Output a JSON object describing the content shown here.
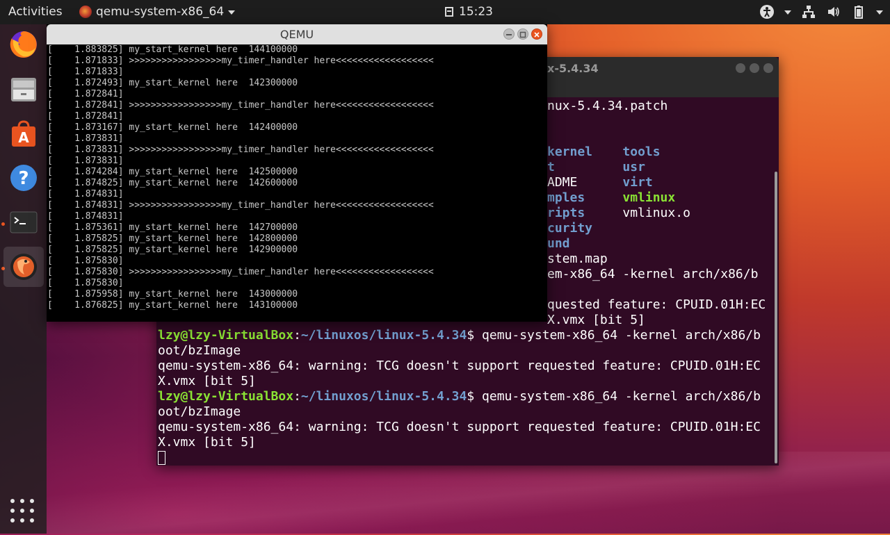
{
  "topbar": {
    "activities": "Activities",
    "app_name": "qemu-system-x86_64",
    "clock": "15:23"
  },
  "dock": {
    "items": [
      "firefox-icon",
      "files-icon",
      "software-icon",
      "help-icon",
      "terminal-icon",
      "qemu-icon"
    ],
    "show_apps": "show-apps-icon"
  },
  "terminal": {
    "title": "x-5.4.34",
    "lines": [
      {
        "parts": [
          {
            "t": "nux-5.4.34.patch",
            "c": "plain"
          }
        ]
      },
      {
        "parts": [
          {
            "t": "",
            "c": "plain"
          }
        ]
      },
      {
        "parts": [
          {
            "t": "",
            "c": "plain"
          }
        ]
      },
      {
        "parts": [
          {
            "t": "kernel",
            "c": "blue"
          },
          {
            "t": "    ",
            "c": "plain"
          },
          {
            "t": "tools",
            "c": "blue"
          }
        ]
      },
      {
        "parts": [
          {
            "t": "t",
            "c": "blue"
          },
          {
            "t": "         ",
            "c": "plain"
          },
          {
            "t": "usr",
            "c": "blue"
          }
        ]
      },
      {
        "parts": [
          {
            "t": "ADME",
            "c": "plain"
          },
          {
            "t": "      ",
            "c": "plain"
          },
          {
            "t": "virt",
            "c": "blue"
          }
        ]
      },
      {
        "parts": [
          {
            "t": "mples",
            "c": "blue"
          },
          {
            "t": "     ",
            "c": "plain"
          },
          {
            "t": "vmlinux",
            "c": "green"
          }
        ]
      },
      {
        "parts": [
          {
            "t": "ripts",
            "c": "blue"
          },
          {
            "t": "     ",
            "c": "plain"
          },
          {
            "t": "vmlinux.o",
            "c": "plain"
          }
        ]
      },
      {
        "parts": [
          {
            "t": "curity",
            "c": "blue"
          }
        ]
      },
      {
        "parts": [
          {
            "t": "und",
            "c": "blue"
          }
        ]
      },
      {
        "parts": [
          {
            "t": "stem.map",
            "c": "plain"
          }
        ]
      },
      {
        "parts": [
          {
            "t": "em-x86_64 -kernel arch/x86/b",
            "c": "plain"
          }
        ]
      },
      {
        "parts": [
          {
            "t": "",
            "c": "plain"
          }
        ]
      },
      {
        "parts": [
          {
            "t": "quested feature: CPUID.01H:EC",
            "c": "plain"
          }
        ]
      },
      {
        "parts": [
          {
            "t": "X.vmx [bit 5]",
            "c": "plain"
          }
        ]
      },
      {
        "parts": [
          {
            "t": "lzy@lzy-VirtualBox",
            "c": "green"
          },
          {
            "t": ":",
            "c": "plain"
          },
          {
            "t": "~/linuxos/linux-5.4.34",
            "c": "blue"
          },
          {
            "t": "$ qemu-system-x86_64 -kernel arch/x86/b",
            "c": "plain"
          }
        ]
      },
      {
        "parts": [
          {
            "t": "oot/bzImage",
            "c": "plain"
          }
        ]
      },
      {
        "parts": [
          {
            "t": "qemu-system-x86_64: warning: TCG doesn't support requested feature: CPUID.01H:EC",
            "c": "plain"
          }
        ]
      },
      {
        "parts": [
          {
            "t": "X.vmx [bit 5]",
            "c": "plain"
          }
        ]
      },
      {
        "parts": [
          {
            "t": "lzy@lzy-VirtualBox",
            "c": "green"
          },
          {
            "t": ":",
            "c": "plain"
          },
          {
            "t": "~/linuxos/linux-5.4.34",
            "c": "blue"
          },
          {
            "t": "$ qemu-system-x86_64 -kernel arch/x86/b",
            "c": "plain"
          }
        ]
      },
      {
        "parts": [
          {
            "t": "oot/bzImage",
            "c": "plain"
          }
        ]
      },
      {
        "parts": [
          {
            "t": "qemu-system-x86_64: warning: TCG doesn't support requested feature: CPUID.01H:EC",
            "c": "plain"
          }
        ]
      },
      {
        "parts": [
          {
            "t": "X.vmx [bit 5]",
            "c": "plain"
          }
        ]
      }
    ]
  },
  "qemu": {
    "title": "QEMU",
    "lines": [
      "[    1.883825] my_start_kernel here  144100000",
      "[    1.871833] >>>>>>>>>>>>>>>>>my_timer_handler here<<<<<<<<<<<<<<<<<<",
      "[    1.871833]",
      "[    1.872493] my_start_kernel here  142300000",
      "[    1.872841]",
      "[    1.872841] >>>>>>>>>>>>>>>>>my_timer_handler here<<<<<<<<<<<<<<<<<<",
      "[    1.872841]",
      "[    1.873167] my_start_kernel here  142400000",
      "[    1.873831]",
      "[    1.873831] >>>>>>>>>>>>>>>>>my_timer_handler here<<<<<<<<<<<<<<<<<<",
      "[    1.873831]",
      "[    1.874284] my_start_kernel here  142500000",
      "[    1.874825] my_start_kernel here  142600000",
      "[    1.874831]",
      "[    1.874831] >>>>>>>>>>>>>>>>>my_timer_handler here<<<<<<<<<<<<<<<<<<",
      "[    1.874831]",
      "[    1.875361] my_start_kernel here  142700000",
      "[    1.875825] my_start_kernel here  142800000",
      "[    1.875825] my_start_kernel here  142900000",
      "[    1.875830]",
      "[    1.875830] >>>>>>>>>>>>>>>>>my_timer_handler here<<<<<<<<<<<<<<<<<<",
      "[    1.875830]",
      "[    1.875958] my_start_kernel here  143000000",
      "[    1.876825] my_start_kernel here  143100000"
    ]
  }
}
